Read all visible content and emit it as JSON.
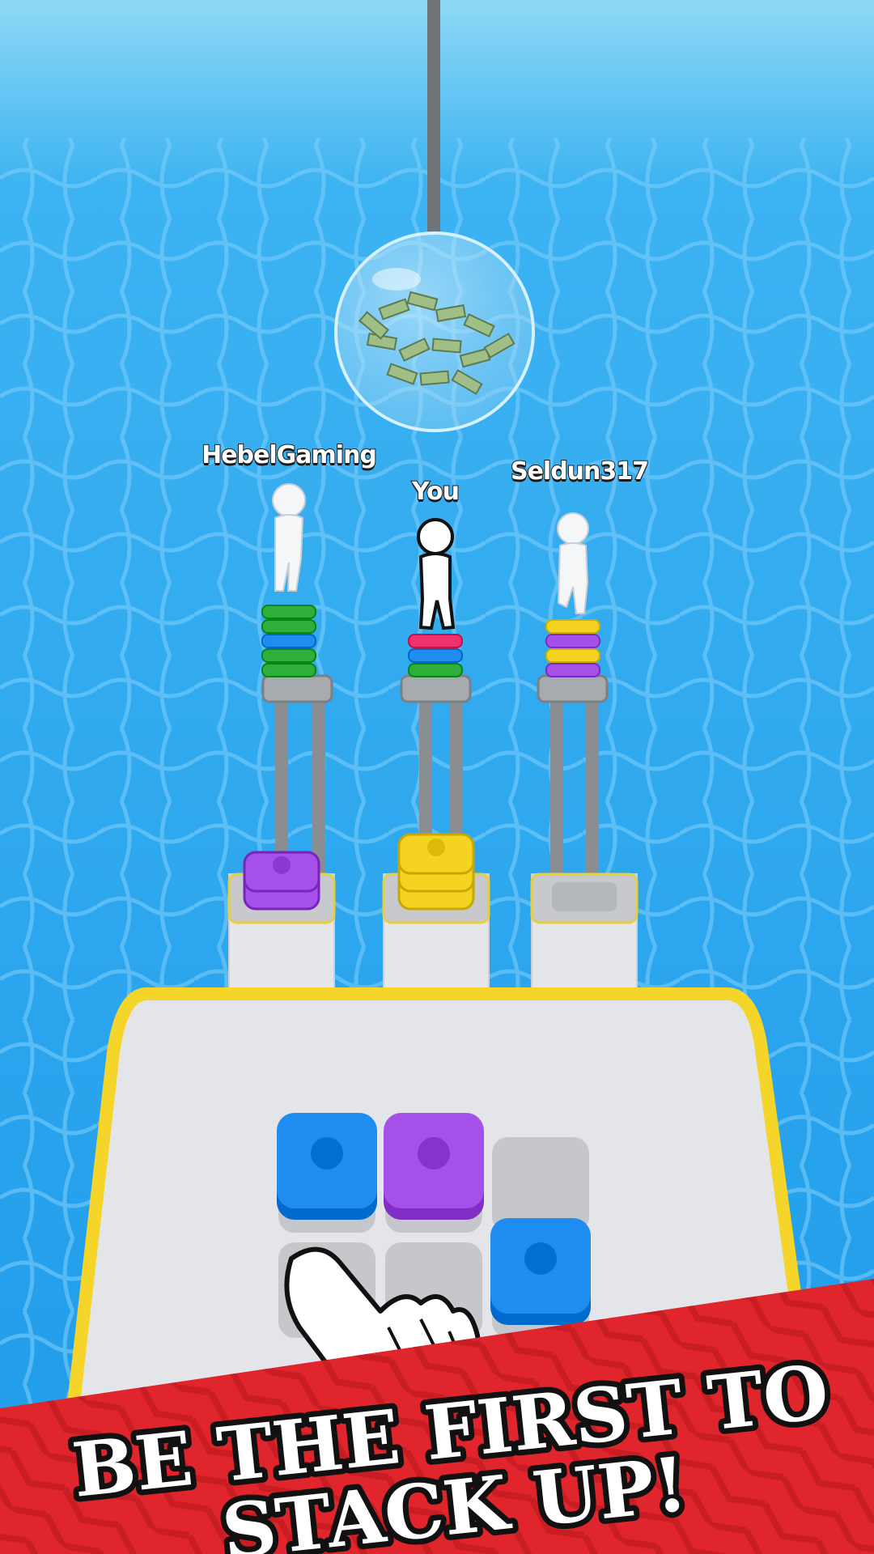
{
  "players": [
    {
      "name": "HebelGaming",
      "stack": [
        "green",
        "green",
        "blue",
        "green",
        "green"
      ]
    },
    {
      "name": "You",
      "stack": [
        "pink",
        "blue",
        "green"
      ]
    },
    {
      "name": "Seldun317",
      "stack": [
        "yellow",
        "purple",
        "yellow",
        "purple"
      ]
    }
  ],
  "slots": [
    {
      "piece": "purple",
      "count": 2
    },
    {
      "piece": "yellow",
      "count": 3
    },
    {
      "piece": null,
      "count": 0
    }
  ],
  "grid": {
    "rows": [
      [
        "blue",
        "purple",
        null
      ],
      [
        null,
        null,
        "blue"
      ]
    ]
  },
  "colors": {
    "blue": "#1f8df0",
    "purple": "#a550e8",
    "yellow": "#f5d421",
    "green": "#2fae3c",
    "pink": "#f0326e",
    "water": "#2ea8f2",
    "board_border": "#f6d52a",
    "banner": "#e0262c"
  },
  "banner": {
    "line1": "BE THE FIRST TO",
    "line2": "STACK UP!"
  },
  "icons": [
    "money-sphere-icon",
    "tap-hand-icon"
  ]
}
